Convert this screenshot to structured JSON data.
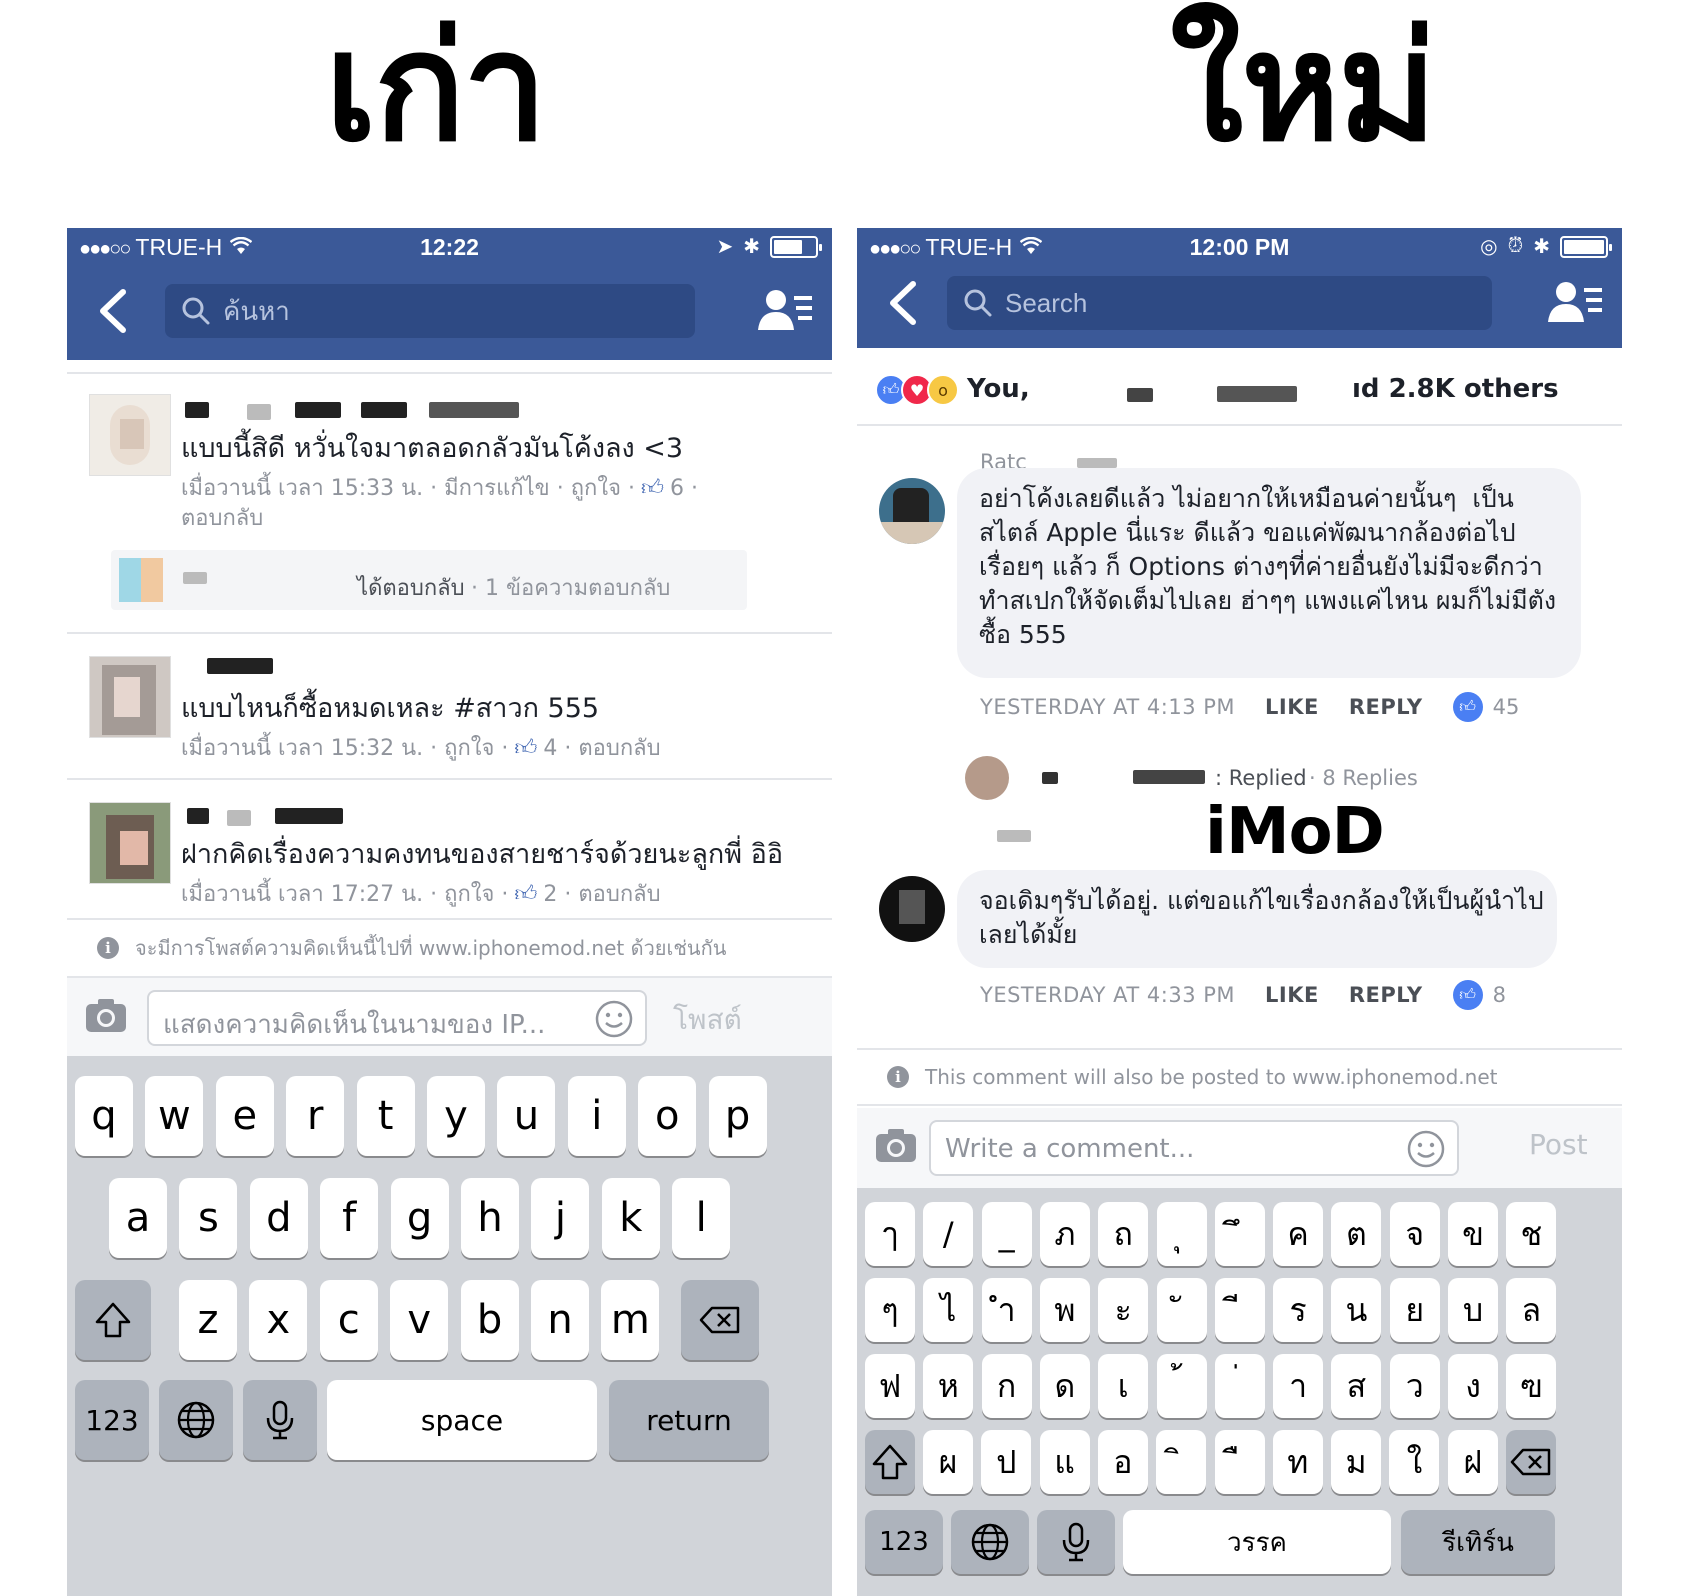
{
  "titles": {
    "old": "เก่า",
    "new": "ใหม่"
  },
  "watermark": "iMoD",
  "old_ui": {
    "status": {
      "carrier": "TRUE-H",
      "signal_dots": "●●●○○",
      "time": "12:22",
      "battery_level": 0.7
    },
    "search_placeholder": "ค้นหา",
    "comments": [
      {
        "text": "แบบนี้สิดี หวั่นใจมาตลอดกลัวมันโค้งลง <3",
        "meta_line1": "เมื่อวานนี้ เวลา 15:33 น. · มีการแก้ไข · ถูกใจ ·",
        "likes": "6",
        "meta_line2": "ตอบกลับ",
        "reply": {
          "label": "ได้ตอบกลับ",
          "count": "· 1 ข้อความตอบกลับ"
        }
      },
      {
        "text": "แบบไหนก็ซื้อหมดเหละ #สาวก 555",
        "meta": "เมื่อวานนี้ เวลา 15:32 น. · ถูกใจ ·",
        "likes": "4",
        "meta_end": "· ตอบกลับ"
      },
      {
        "text": "ฝากคิดเรื่องความคงทนของสายชาร์จด้วยนะลูกพี่ อิอิ",
        "meta": "เมื่อวานนี้ เวลา 17:27 น. · ถูกใจ ·",
        "likes": "2",
        "meta_end": "· ตอบกลับ"
      }
    ],
    "info_text": "จะมีการโพสต์ความคิดเห็นนี้ไปที่ www.iphonemod.net ด้วยเช่นกัน",
    "compose_placeholder": "แสดงความคิดเห็นในนามของ IP...",
    "post_label": "โพสต์",
    "keyboard": {
      "row1": [
        "q",
        "w",
        "e",
        "r",
        "t",
        "y",
        "u",
        "i",
        "o",
        "p"
      ],
      "row2": [
        "a",
        "s",
        "d",
        "f",
        "g",
        "h",
        "j",
        "k",
        "l"
      ],
      "row3": [
        "z",
        "x",
        "c",
        "v",
        "b",
        "n",
        "m"
      ],
      "num": "123",
      "space": "space",
      "return": "return"
    }
  },
  "new_ui": {
    "status": {
      "carrier": "TRUE-H",
      "signal_dots": "●●●○○",
      "time": "12:00 PM",
      "battery_level": 1.0
    },
    "search_placeholder": "Search",
    "reactions_text_start": "You,",
    "reactions_text_end": "ıd 2.8K others",
    "comment1_author_partial": "Ratc",
    "comment1": {
      "text": "อย่าโค้งเลยดีแล้ว ไม่อยากให้เหมือนค่ายนั้นๆ  เป็น\nสไตล์ Apple นี่แระ ดีแล้ว ขอแค่พัฒนากล้องต่อไป\nเรื่อยๆ แล้ว ก็ Options ต่างๆที่ค่ายอื่นยังไม่มีจะดีกว่า\nทำสเปกให้จัดเต็มไปเลย ฮ่าๆๆ แพงแค่ไหน ผมก็ไม่มีตัง\nซื้อ 555",
      "time": "YESTERDAY AT 4:13 PM",
      "like": "LIKE",
      "reply": "REPLY",
      "likes": "45"
    },
    "replied_text": ": Replied",
    "replies_count": "· 8 Replies",
    "comment2": {
      "text": "จอเดิมๆรับได้อยู่. แต่ขอแก้ไขเรื่องกล้องให้เป็นผู้นำไป\nเลยได้มั้ย",
      "time": "YESTERDAY AT 4:33 PM",
      "like": "LIKE",
      "reply": "REPLY",
      "likes": "8"
    },
    "info_text": "This comment will also be posted to www.iphonemod.net",
    "compose_placeholder": "Write a comment...",
    "post_label": "Post",
    "keyboard": {
      "row1": [
        "ๅ",
        "/",
        "_",
        "ภ",
        "ถ",
        "ุ",
        "ึ",
        "ค",
        "ต",
        "จ",
        "ข",
        "ช"
      ],
      "row2": [
        "ๆ",
        "ไ",
        "ำ",
        "พ",
        "ะ",
        "ั",
        "ี",
        "ร",
        "น",
        "ย",
        "บ",
        "ล"
      ],
      "row3": [
        "ฟ",
        "ห",
        "ก",
        "ด",
        "เ",
        "้",
        "่",
        "า",
        "ส",
        "ว",
        "ง",
        "ฃ"
      ],
      "row4": [
        "ผ",
        "ป",
        "แ",
        "อ",
        "ิ",
        "ื",
        "ท",
        "ม",
        "ใ",
        "ฝ"
      ],
      "num": "123",
      "space": "วรรค",
      "return": "รีเทิร์น"
    }
  },
  "colors": {
    "facebook_blue": "#3b5998",
    "like_blue": "#4a7ff3",
    "keyboard_bg": "#d1d4d9"
  }
}
